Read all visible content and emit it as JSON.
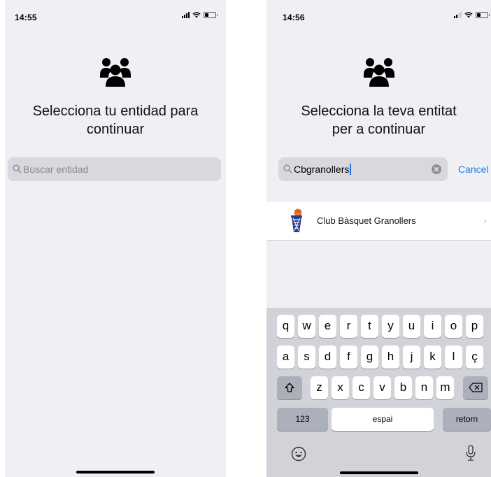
{
  "left_screen": {
    "status": {
      "time": "14:55"
    },
    "title": "Selecciona tu entidad para continuar",
    "search": {
      "placeholder": "Buscar entidad"
    }
  },
  "right_screen": {
    "status": {
      "time": "14:56"
    },
    "title": "Selecciona la teva entitat per a continuar",
    "search": {
      "value": "Cbgranollers"
    },
    "cancel_label": "Cancel",
    "results": [
      {
        "label": "Club Bàsquet Granollers"
      }
    ],
    "keyboard": {
      "row1": [
        "q",
        "w",
        "e",
        "r",
        "t",
        "y",
        "u",
        "i",
        "o",
        "p"
      ],
      "row2": [
        "a",
        "s",
        "d",
        "f",
        "g",
        "h",
        "j",
        "k",
        "l",
        "ç"
      ],
      "row3": [
        "z",
        "x",
        "c",
        "v",
        "b",
        "n",
        "m"
      ],
      "numbers_label": "123",
      "space_label": "espai",
      "return_label": "retorn"
    }
  },
  "icons": [
    "group-icon",
    "search-icon",
    "clear-icon",
    "chevron-right-icon",
    "shift-icon",
    "backspace-icon",
    "emoji-icon",
    "microphone-icon",
    "club-logo-icon"
  ],
  "colors": {
    "accent": "#1a7cf5",
    "background": "#efeff4",
    "search_field": "#d8d8de"
  }
}
